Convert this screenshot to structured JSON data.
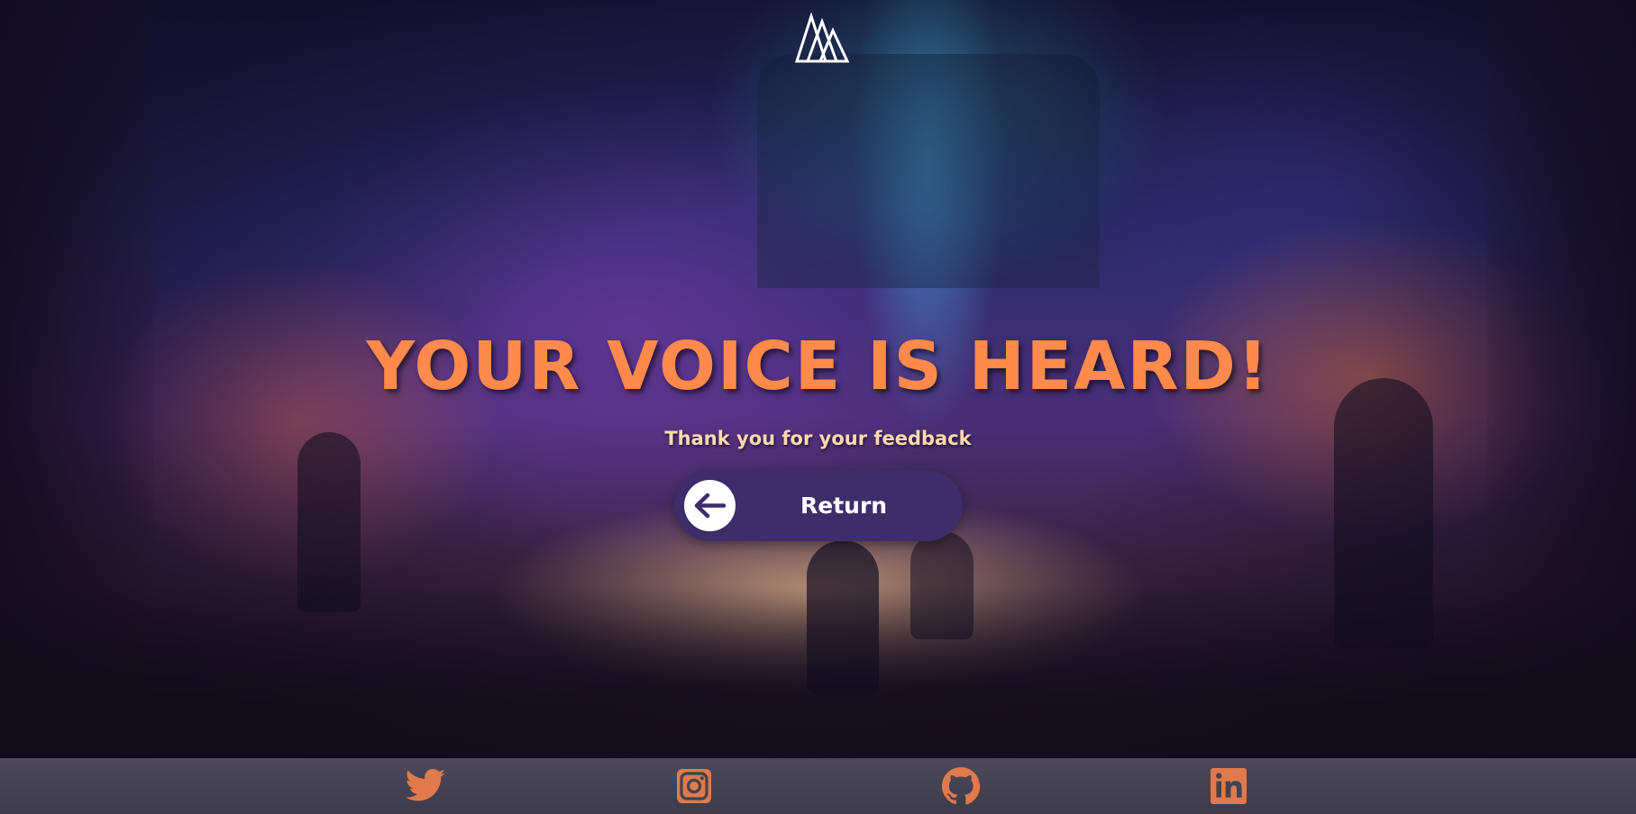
{
  "logo": {
    "icon": "triangle-logo-icon"
  },
  "headline": "YOUR VOICE IS HEARD!",
  "subtitle": "Thank you for your feedback",
  "return_button": {
    "label": "Return",
    "icon": "arrow-left-icon"
  },
  "footer": {
    "socials": [
      {
        "name": "Twitter",
        "icon": "twitter-icon"
      },
      {
        "name": "Instagram",
        "icon": "instagram-icon"
      },
      {
        "name": "GitHub",
        "icon": "github-icon"
      },
      {
        "name": "LinkedIn",
        "icon": "linkedin-icon"
      }
    ]
  },
  "colors": {
    "headline": "#ff8a4c",
    "subtitle": "#ffd9b0",
    "button_bg": "#3d2d6b",
    "footer_bg": "#44424f",
    "social_icon": "#e07a4c"
  }
}
